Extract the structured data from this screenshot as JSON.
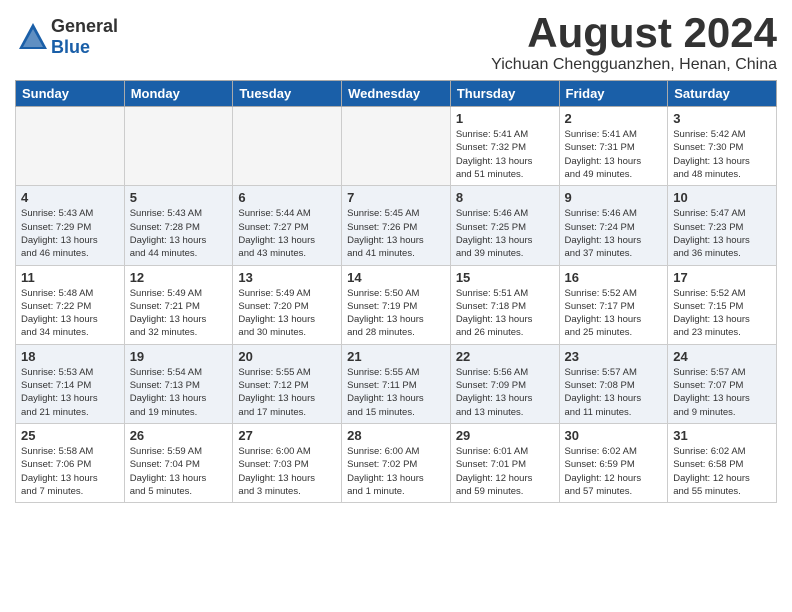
{
  "header": {
    "logo_general": "General",
    "logo_blue": "Blue",
    "month_year": "August 2024",
    "location": "Yichuan Chengguanzhen, Henan, China"
  },
  "days_of_week": [
    "Sunday",
    "Monday",
    "Tuesday",
    "Wednesday",
    "Thursday",
    "Friday",
    "Saturday"
  ],
  "weeks": [
    {
      "days": [
        {
          "date": "",
          "info": ""
        },
        {
          "date": "",
          "info": ""
        },
        {
          "date": "",
          "info": ""
        },
        {
          "date": "",
          "info": ""
        },
        {
          "date": "1",
          "info": "Sunrise: 5:41 AM\nSunset: 7:32 PM\nDaylight: 13 hours\nand 51 minutes."
        },
        {
          "date": "2",
          "info": "Sunrise: 5:41 AM\nSunset: 7:31 PM\nDaylight: 13 hours\nand 49 minutes."
        },
        {
          "date": "3",
          "info": "Sunrise: 5:42 AM\nSunset: 7:30 PM\nDaylight: 13 hours\nand 48 minutes."
        }
      ]
    },
    {
      "days": [
        {
          "date": "4",
          "info": "Sunrise: 5:43 AM\nSunset: 7:29 PM\nDaylight: 13 hours\nand 46 minutes."
        },
        {
          "date": "5",
          "info": "Sunrise: 5:43 AM\nSunset: 7:28 PM\nDaylight: 13 hours\nand 44 minutes."
        },
        {
          "date": "6",
          "info": "Sunrise: 5:44 AM\nSunset: 7:27 PM\nDaylight: 13 hours\nand 43 minutes."
        },
        {
          "date": "7",
          "info": "Sunrise: 5:45 AM\nSunset: 7:26 PM\nDaylight: 13 hours\nand 41 minutes."
        },
        {
          "date": "8",
          "info": "Sunrise: 5:46 AM\nSunset: 7:25 PM\nDaylight: 13 hours\nand 39 minutes."
        },
        {
          "date": "9",
          "info": "Sunrise: 5:46 AM\nSunset: 7:24 PM\nDaylight: 13 hours\nand 37 minutes."
        },
        {
          "date": "10",
          "info": "Sunrise: 5:47 AM\nSunset: 7:23 PM\nDaylight: 13 hours\nand 36 minutes."
        }
      ]
    },
    {
      "days": [
        {
          "date": "11",
          "info": "Sunrise: 5:48 AM\nSunset: 7:22 PM\nDaylight: 13 hours\nand 34 minutes."
        },
        {
          "date": "12",
          "info": "Sunrise: 5:49 AM\nSunset: 7:21 PM\nDaylight: 13 hours\nand 32 minutes."
        },
        {
          "date": "13",
          "info": "Sunrise: 5:49 AM\nSunset: 7:20 PM\nDaylight: 13 hours\nand 30 minutes."
        },
        {
          "date": "14",
          "info": "Sunrise: 5:50 AM\nSunset: 7:19 PM\nDaylight: 13 hours\nand 28 minutes."
        },
        {
          "date": "15",
          "info": "Sunrise: 5:51 AM\nSunset: 7:18 PM\nDaylight: 13 hours\nand 26 minutes."
        },
        {
          "date": "16",
          "info": "Sunrise: 5:52 AM\nSunset: 7:17 PM\nDaylight: 13 hours\nand 25 minutes."
        },
        {
          "date": "17",
          "info": "Sunrise: 5:52 AM\nSunset: 7:15 PM\nDaylight: 13 hours\nand 23 minutes."
        }
      ]
    },
    {
      "days": [
        {
          "date": "18",
          "info": "Sunrise: 5:53 AM\nSunset: 7:14 PM\nDaylight: 13 hours\nand 21 minutes."
        },
        {
          "date": "19",
          "info": "Sunrise: 5:54 AM\nSunset: 7:13 PM\nDaylight: 13 hours\nand 19 minutes."
        },
        {
          "date": "20",
          "info": "Sunrise: 5:55 AM\nSunset: 7:12 PM\nDaylight: 13 hours\nand 17 minutes."
        },
        {
          "date": "21",
          "info": "Sunrise: 5:55 AM\nSunset: 7:11 PM\nDaylight: 13 hours\nand 15 minutes."
        },
        {
          "date": "22",
          "info": "Sunrise: 5:56 AM\nSunset: 7:09 PM\nDaylight: 13 hours\nand 13 minutes."
        },
        {
          "date": "23",
          "info": "Sunrise: 5:57 AM\nSunset: 7:08 PM\nDaylight: 13 hours\nand 11 minutes."
        },
        {
          "date": "24",
          "info": "Sunrise: 5:57 AM\nSunset: 7:07 PM\nDaylight: 13 hours\nand 9 minutes."
        }
      ]
    },
    {
      "days": [
        {
          "date": "25",
          "info": "Sunrise: 5:58 AM\nSunset: 7:06 PM\nDaylight: 13 hours\nand 7 minutes."
        },
        {
          "date": "26",
          "info": "Sunrise: 5:59 AM\nSunset: 7:04 PM\nDaylight: 13 hours\nand 5 minutes."
        },
        {
          "date": "27",
          "info": "Sunrise: 6:00 AM\nSunset: 7:03 PM\nDaylight: 13 hours\nand 3 minutes."
        },
        {
          "date": "28",
          "info": "Sunrise: 6:00 AM\nSunset: 7:02 PM\nDaylight: 13 hours\nand 1 minute."
        },
        {
          "date": "29",
          "info": "Sunrise: 6:01 AM\nSunset: 7:01 PM\nDaylight: 12 hours\nand 59 minutes."
        },
        {
          "date": "30",
          "info": "Sunrise: 6:02 AM\nSunset: 6:59 PM\nDaylight: 12 hours\nand 57 minutes."
        },
        {
          "date": "31",
          "info": "Sunrise: 6:02 AM\nSunset: 6:58 PM\nDaylight: 12 hours\nand 55 minutes."
        }
      ]
    }
  ]
}
